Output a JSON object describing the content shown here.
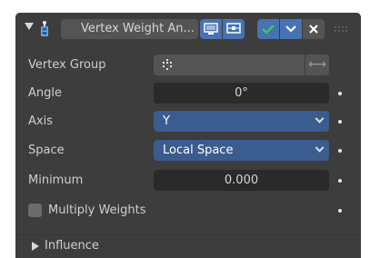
{
  "header": {
    "modifier_name": "Vertex Weight An...",
    "icons": {
      "collapse": "disclosure-triangle-down-icon",
      "modifier": "vertex-weight-modifier-icon",
      "edit_mode": "edit-mode-icon",
      "realtime": "monitor-icon",
      "apply": "checkmark-icon",
      "menu": "chevron-down-icon",
      "delete": "close-icon",
      "drag": "drag-handle-icon"
    }
  },
  "fields": {
    "vertex_group": {
      "label": "Vertex Group",
      "value": ""
    },
    "angle": {
      "label": "Angle",
      "value": "0°"
    },
    "axis": {
      "label": "Axis",
      "value": "Y"
    },
    "space": {
      "label": "Space",
      "value": "Local Space"
    },
    "minimum": {
      "label": "Minimum",
      "value": "0.000"
    },
    "multiply_weights": {
      "label": "Multiply Weights",
      "checked": false
    }
  },
  "subpanel": {
    "influence_label": "Influence"
  },
  "colors": {
    "panel_bg": "#3d3d3d",
    "field_bg": "#2a2a2a",
    "select_bg": "#3a5c8f",
    "accent_blue": "#4772b3",
    "apply_green": "#3cb043"
  }
}
